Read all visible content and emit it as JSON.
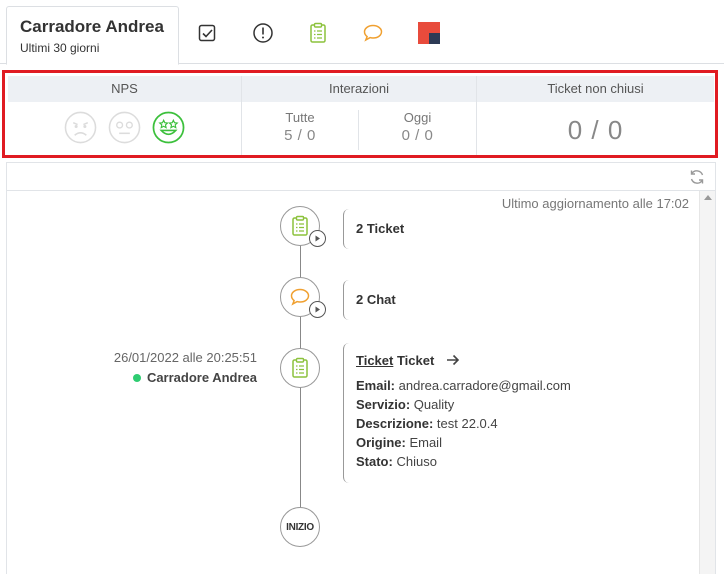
{
  "header": {
    "title": "Carradore Andrea",
    "subtitle": "Ultimi 30 giorni",
    "tabs": [
      {
        "icon": "check-square-icon"
      },
      {
        "icon": "exclamation-circle-icon"
      },
      {
        "icon": "clipboard-icon"
      },
      {
        "icon": "chat-bubble-icon"
      },
      {
        "icon": "brand-logo-icon"
      }
    ]
  },
  "stats": {
    "nps": {
      "label": "NPS",
      "selected": "happy"
    },
    "interactions": {
      "label": "Interazioni",
      "all_label": "Tutte",
      "all_value": "5 / 0",
      "today_label": "Oggi",
      "today_value": "0 / 0"
    },
    "open_tickets": {
      "label": "Ticket non chiusi",
      "value": "0 / 0"
    }
  },
  "timeline": {
    "updated": "Ultimo aggiornamento alle 17:02",
    "groups": [
      {
        "label": "2 Ticket"
      },
      {
        "label": "2 Chat"
      }
    ],
    "event": {
      "date": "26/01/2022 alle 20:25:51",
      "agent": "Carradore Andrea",
      "title_link": "Ticket",
      "title_rest": " Ticket",
      "fields": [
        {
          "key": "Email:",
          "value": " andrea.carradore@gmail.com"
        },
        {
          "key": "Servizio:",
          "value": " Quality"
        },
        {
          "key": "Descrizione:",
          "value": " test 22.0.4"
        },
        {
          "key": "Origine:",
          "value": " Email"
        },
        {
          "key": "Stato:",
          "value": " Chiuso"
        }
      ]
    },
    "start_label": "INIZIO"
  },
  "colors": {
    "accent_green": "#3cc03c",
    "chat_orange": "#f0a030",
    "clipboard_green": "#8cc23c",
    "highlight_red": "#e01b22",
    "online_dot": "#2ecc71"
  }
}
